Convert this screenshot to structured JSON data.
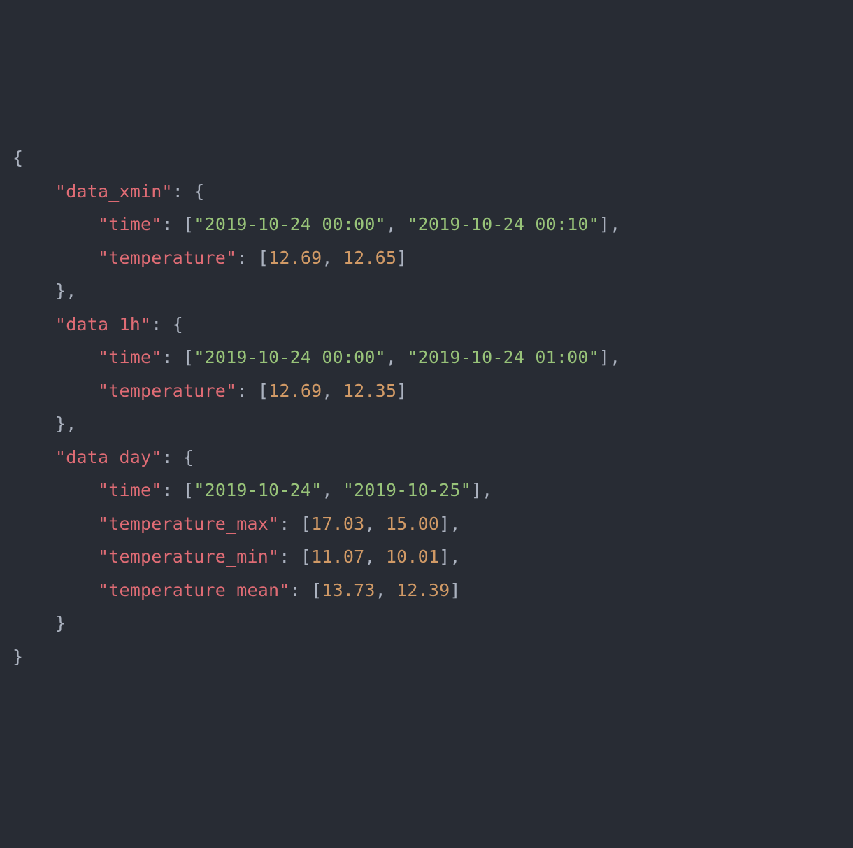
{
  "lines": {
    "l0": {
      "brace": "{"
    },
    "l1": {
      "indent": "    ",
      "key": "\"data_xmin\"",
      "after": ": {"
    },
    "l2": {
      "indent": "        ",
      "key": "\"time\"",
      "colon": ": ",
      "lb": "[",
      "s0": "\"2019-10-24 00:00\"",
      "comma0": ", ",
      "s1": "\"2019-10-24 00:10\"",
      "rb": "]",
      "tail": ","
    },
    "l3": {
      "indent": "        ",
      "key": "\"temperature\"",
      "colon": ": ",
      "lb": "[",
      "n0": "12.69",
      "comma0": ", ",
      "n1": "12.65",
      "rb": "]"
    },
    "l4": {
      "indent": "    ",
      "brace": "},"
    },
    "l5": {
      "indent": "    ",
      "key": "\"data_1h\"",
      "after": ": {"
    },
    "l6": {
      "indent": "        ",
      "key": "\"time\"",
      "colon": ": ",
      "lb": "[",
      "s0": "\"2019-10-24 00:00\"",
      "comma0": ", ",
      "s1": "\"2019-10-24 01:00\"",
      "rb": "]",
      "tail": ","
    },
    "l7": {
      "indent": "        ",
      "key": "\"temperature\"",
      "colon": ": ",
      "lb": "[",
      "n0": "12.69",
      "comma0": ", ",
      "n1": "12.35",
      "rb": "]"
    },
    "l8": {
      "indent": "    ",
      "brace": "},"
    },
    "l9": {
      "indent": "    ",
      "key": "\"data_day\"",
      "after": ": {"
    },
    "l10": {
      "indent": "        ",
      "key": "\"time\"",
      "colon": ": ",
      "lb": "[",
      "s0": "\"2019-10-24\"",
      "comma0": ", ",
      "s1": "\"2019-10-25\"",
      "rb": "]",
      "tail": ","
    },
    "l11": {
      "indent": "        ",
      "key": "\"temperature_max\"",
      "colon": ": ",
      "lb": "[",
      "n0": "17.03",
      "comma0": ", ",
      "n1": "15.00",
      "rb": "]",
      "tail": ","
    },
    "l12": {
      "indent": "        ",
      "key": "\"temperature_min\"",
      "colon": ": ",
      "lb": "[",
      "n0": "11.07",
      "comma0": ", ",
      "n1": "10.01",
      "rb": "]",
      "tail": ","
    },
    "l13": {
      "indent": "        ",
      "key": "\"temperature_mean\"",
      "colon": ": ",
      "lb": "[",
      "n0": "13.73",
      "comma0": ", ",
      "n1": "12.39",
      "rb": "]"
    },
    "l14": {
      "indent": "    ",
      "brace": "}"
    },
    "l15": {
      "brace": "}"
    }
  }
}
